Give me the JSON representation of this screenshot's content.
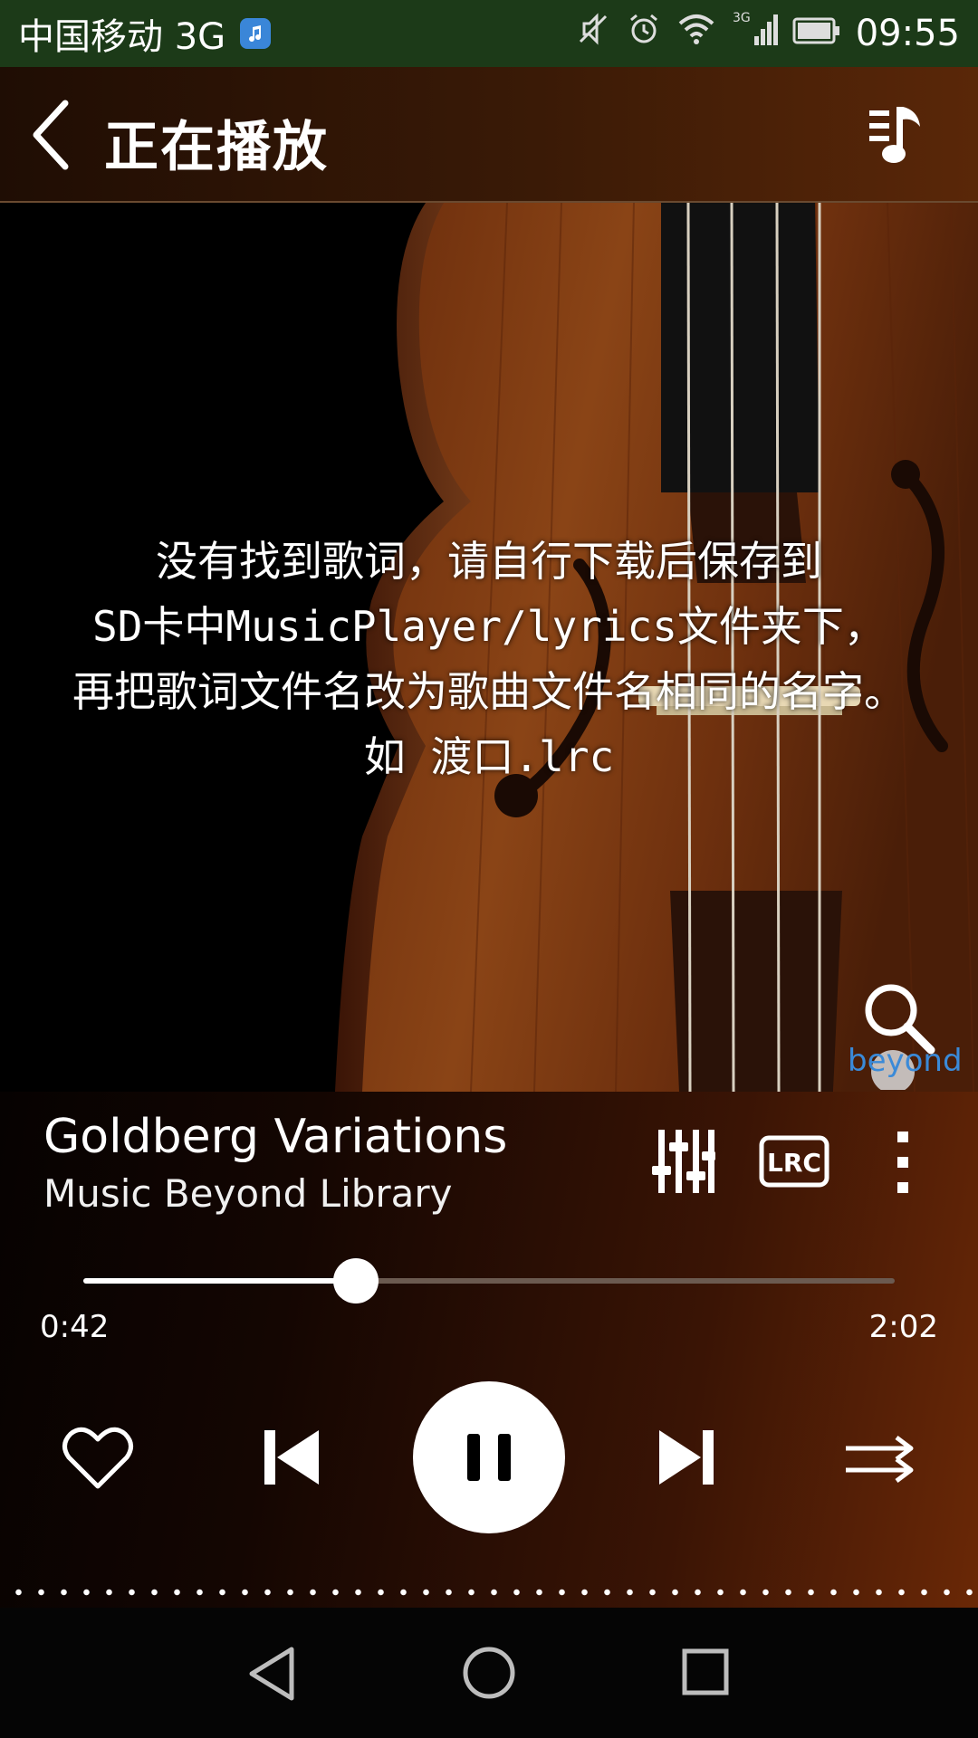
{
  "status_bar": {
    "carrier": "中国移动 3G",
    "network_type": "3G",
    "time": "09:55",
    "icons": [
      "music-app-icon",
      "mute-icon",
      "alarm-icon",
      "wifi-icon",
      "signal-icon",
      "battery-icon"
    ]
  },
  "header": {
    "title": "正在播放",
    "back_icon": "back-chevron-icon",
    "playlist_icon": "playlist-music-icon"
  },
  "album": {
    "lyrics_not_found_lines": [
      "没有找到歌词，请自行下载后保存到",
      "SD卡中MusicPlayer/lyrics文件夹下，",
      "再把歌词文件名改为歌曲文件名相同的名字。",
      "如 渡口.lrc"
    ],
    "logo_text": "beyond",
    "search_icon": "search-icon"
  },
  "track": {
    "title": "Goldberg Variations",
    "artist": "Music Beyond Library"
  },
  "track_actions": {
    "equalizer_icon": "equalizer-icon",
    "lrc_label": "LRC",
    "more_icon": "more-vertical-icon"
  },
  "playback": {
    "elapsed": "0:42",
    "total": "2:02",
    "progress_fraction": 0.336
  },
  "controls": {
    "favorite_icon": "heart-icon",
    "previous_icon": "skip-previous-icon",
    "pause_icon": "pause-icon",
    "next_icon": "skip-next-icon",
    "mode_icon": "sequential-play-icon"
  },
  "nav": {
    "back_icon": "nav-back-icon",
    "home_icon": "nav-home-icon",
    "recents_icon": "nav-recents-icon"
  },
  "colors": {
    "status_bar": "#1c3a18",
    "accent": "#ffffff",
    "wood": "#7a3a12",
    "background": "#000000"
  }
}
